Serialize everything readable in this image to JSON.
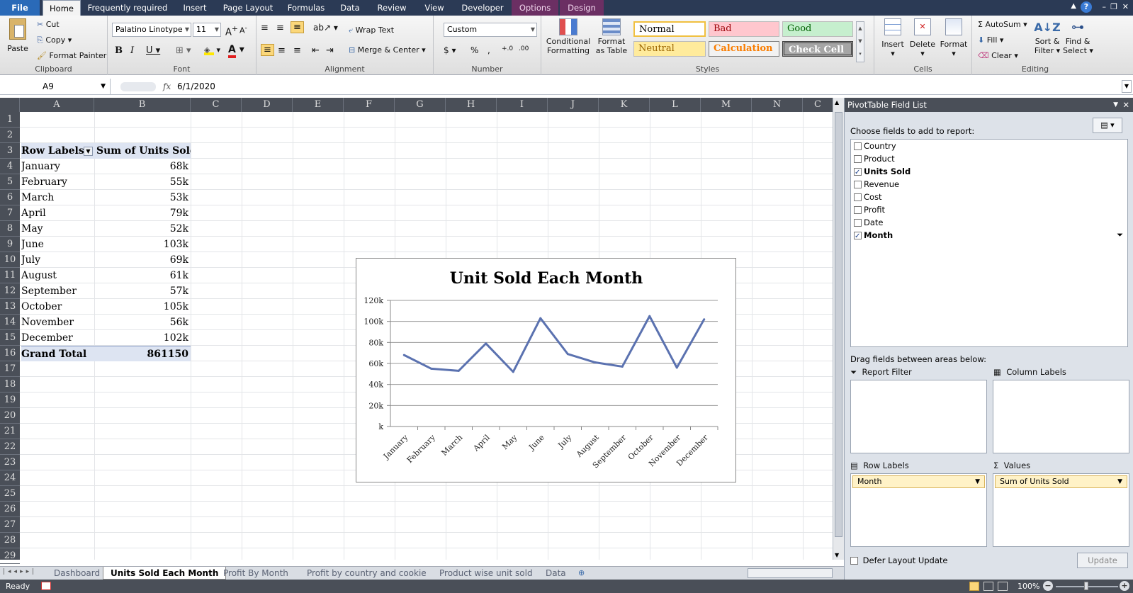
{
  "ribbon_tabs": [
    "File",
    "Home",
    "Frequently required",
    "Insert",
    "Page Layout",
    "Formulas",
    "Data",
    "Review",
    "View",
    "Developer",
    "Options",
    "Design"
  ],
  "clipboard": {
    "paste": "Paste",
    "cut": "Cut",
    "copy": "Copy",
    "format_painter": "Format Painter",
    "label": "Clipboard"
  },
  "font": {
    "name": "Palatino Linotype",
    "size": "11",
    "label": "Font"
  },
  "alignment": {
    "wrap_text": "Wrap Text",
    "merge_center": "Merge & Center",
    "label": "Alignment"
  },
  "number": {
    "format": "Custom",
    "label": "Number"
  },
  "styles": {
    "conditional": "Conditional",
    "conditional2": "Formatting",
    "format_table": "Format",
    "format_table2": "as Table",
    "normal": "Normal",
    "bad": "Bad",
    "good": "Good",
    "neutral": "Neutral",
    "calculation": "Calculation",
    "check_cell": "Check Cell",
    "label": "Styles"
  },
  "cells": {
    "insert": "Insert",
    "delete": "Delete",
    "format": "Format",
    "label": "Cells"
  },
  "editing": {
    "autosum": "AutoSum",
    "fill": "Fill",
    "clear": "Clear",
    "sort_filter": "Sort &",
    "sort_filter2": "Filter",
    "find_select": "Find &",
    "find_select2": "Select",
    "label": "Editing"
  },
  "formula_bar": {
    "name_box": "A9",
    "fx": "fx",
    "value": "6/1/2020"
  },
  "columns": [
    "A",
    "B",
    "C",
    "D",
    "E",
    "F",
    "G",
    "H",
    "I",
    "J",
    "K",
    "L",
    "M",
    "N",
    "C"
  ],
  "rows": [
    "1",
    "2",
    "3",
    "4",
    "5",
    "6",
    "7",
    "8",
    "9",
    "10",
    "11",
    "12",
    "13",
    "14",
    "15",
    "16",
    "17",
    "18",
    "19",
    "20",
    "21",
    "22",
    "23",
    "24",
    "25",
    "26",
    "27",
    "28",
    "29"
  ],
  "pivot": {
    "header_label": "Row Labels",
    "header_value": "Sum of Units Sold",
    "rows": [
      {
        "label": "January",
        "value": "68k"
      },
      {
        "label": "February",
        "value": "55k"
      },
      {
        "label": "March",
        "value": "53k"
      },
      {
        "label": "April",
        "value": "79k"
      },
      {
        "label": "May",
        "value": "52k"
      },
      {
        "label": "June",
        "value": "103k"
      },
      {
        "label": "July",
        "value": "69k"
      },
      {
        "label": "August",
        "value": "61k"
      },
      {
        "label": "September",
        "value": "57k"
      },
      {
        "label": "October",
        "value": "105k"
      },
      {
        "label": "November",
        "value": "56k"
      },
      {
        "label": "December",
        "value": "102k"
      }
    ],
    "total_label": "Grand Total",
    "total_value": "861150"
  },
  "chart_data": {
    "type": "line",
    "title": "Unit Sold Each Month",
    "categories": [
      "January",
      "February",
      "March",
      "April",
      "May",
      "June",
      "July",
      "August",
      "September",
      "October",
      "November",
      "December"
    ],
    "values": [
      68,
      55,
      53,
      79,
      52,
      103,
      69,
      61,
      57,
      105,
      56,
      102
    ],
    "yticks": [
      "k",
      "20k",
      "40k",
      "60k",
      "80k",
      "100k",
      "120k"
    ],
    "ylim": [
      0,
      120
    ],
    "grid": true,
    "color": "#5b72b0"
  },
  "sheet_tabs": [
    "Dashboard",
    "Units Sold Each Month",
    "Profit By Month",
    "Profit by country and cookie",
    "Product wise unit sold",
    "Data"
  ],
  "active_sheet": "Units Sold Each Month",
  "status": {
    "ready": "Ready",
    "zoom": "100%"
  },
  "field_list": {
    "title": "PivotTable Field List",
    "choose": "Choose fields to add to report:",
    "fields": [
      {
        "name": "Country",
        "checked": false
      },
      {
        "name": "Product",
        "checked": false
      },
      {
        "name": "Units Sold",
        "checked": true
      },
      {
        "name": "Revenue",
        "checked": false
      },
      {
        "name": "Cost",
        "checked": false
      },
      {
        "name": "Profit",
        "checked": false
      },
      {
        "name": "Date",
        "checked": false
      },
      {
        "name": "Month",
        "checked": true
      }
    ],
    "drag_label": "Drag fields between areas below:",
    "report_filter": "Report Filter",
    "column_labels": "Column Labels",
    "row_labels": "Row Labels",
    "values": "Values",
    "row_item": "Month",
    "value_item": "Sum of Units Sold",
    "defer": "Defer Layout Update",
    "update": "Update"
  }
}
